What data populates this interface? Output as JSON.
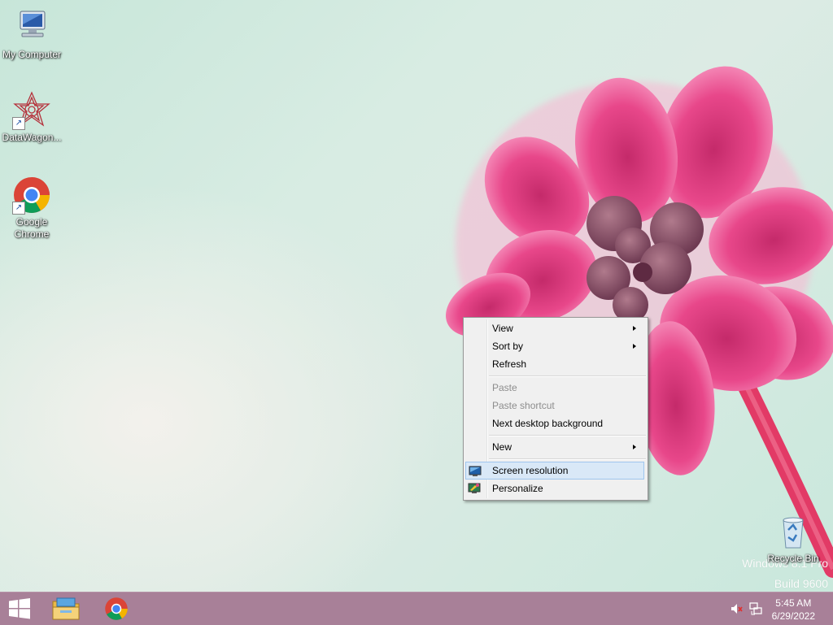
{
  "desktop": {
    "icons": [
      {
        "label": "My Computer",
        "icon": "computer-icon"
      },
      {
        "label": "DataWagon...",
        "icon": "datawagon-icon"
      },
      {
        "label": "Google Chrome",
        "icon": "chrome-icon"
      },
      {
        "label": "Recycle Bin",
        "icon": "recycle-bin-icon"
      }
    ],
    "watermark": {
      "line1": "Windows 8.1 Pro",
      "line2": "Build 9600"
    }
  },
  "context_menu": {
    "items": [
      {
        "label": "View",
        "submenu": true,
        "enabled": true
      },
      {
        "label": "Sort by",
        "submenu": true,
        "enabled": true
      },
      {
        "label": "Refresh",
        "submenu": false,
        "enabled": true
      },
      {
        "label": "Paste",
        "submenu": false,
        "enabled": false
      },
      {
        "label": "Paste shortcut",
        "submenu": false,
        "enabled": false
      },
      {
        "label": "Next desktop background",
        "submenu": false,
        "enabled": true
      },
      {
        "label": "New",
        "submenu": true,
        "enabled": true
      },
      {
        "label": "Screen resolution",
        "submenu": false,
        "enabled": true,
        "highlighted": true,
        "icon": "screen-resolution-icon"
      },
      {
        "label": "Personalize",
        "submenu": false,
        "enabled": true,
        "icon": "personalize-icon"
      }
    ]
  },
  "taskbar": {
    "buttons": [
      {
        "name": "start",
        "icon": "windows-logo-icon"
      },
      {
        "name": "file-explorer",
        "icon": "file-explorer-icon"
      },
      {
        "name": "google-chrome",
        "icon": "chrome-icon"
      }
    ],
    "tray": {
      "volume_icon": "volume-muted-icon",
      "network_icon": "network-icon",
      "time": "5:45 AM",
      "date": "6/29/2022"
    }
  },
  "colors": {
    "taskbar": "#a88098",
    "menu_highlight": "#d9e8f7",
    "flower": "#e8387f"
  }
}
